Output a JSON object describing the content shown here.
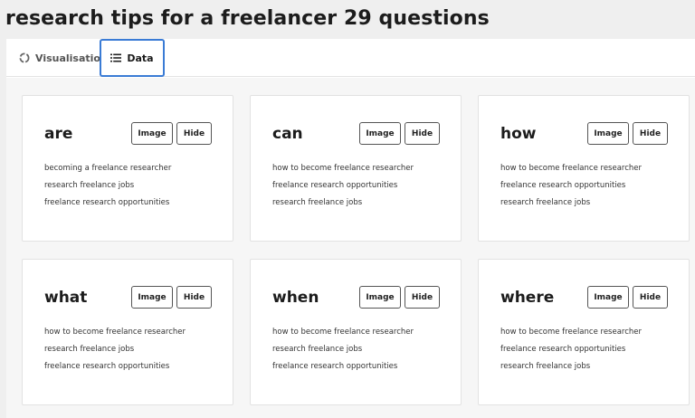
{
  "page": {
    "title": "research tips for a freelancer 29 questions"
  },
  "tabs": [
    {
      "label": "Visualisation",
      "icon": "circle-dashed-icon",
      "active": false
    },
    {
      "label": "Data",
      "icon": "list-icon",
      "active": true
    }
  ],
  "colors": {
    "accent": "#3a7bd5",
    "background": "#efefef",
    "grid_background": "#f6f6f6"
  },
  "cards": [
    {
      "title": "are",
      "image_label": "Image",
      "hide_label": "Hide",
      "items": [
        "becoming a freelance researcher",
        "research freelance jobs",
        "freelance research opportunities"
      ]
    },
    {
      "title": "can",
      "image_label": "Image",
      "hide_label": "Hide",
      "items": [
        "how to become freelance researcher",
        "freelance research opportunities",
        "research freelance jobs"
      ]
    },
    {
      "title": "how",
      "image_label": "Image",
      "hide_label": "Hide",
      "items": [
        "how to become freelance researcher",
        "freelance research opportunities",
        "research freelance jobs"
      ]
    },
    {
      "title": "what",
      "image_label": "Image",
      "hide_label": "Hide",
      "items": [
        "how to become freelance researcher",
        "research freelance jobs",
        "freelance research opportunities"
      ]
    },
    {
      "title": "when",
      "image_label": "Image",
      "hide_label": "Hide",
      "items": [
        "how to become freelance researcher",
        "research freelance jobs",
        "freelance research opportunities"
      ]
    },
    {
      "title": "where",
      "image_label": "Image",
      "hide_label": "Hide",
      "items": [
        "how to become freelance researcher",
        "freelance research opportunities",
        "research freelance jobs"
      ]
    }
  ]
}
